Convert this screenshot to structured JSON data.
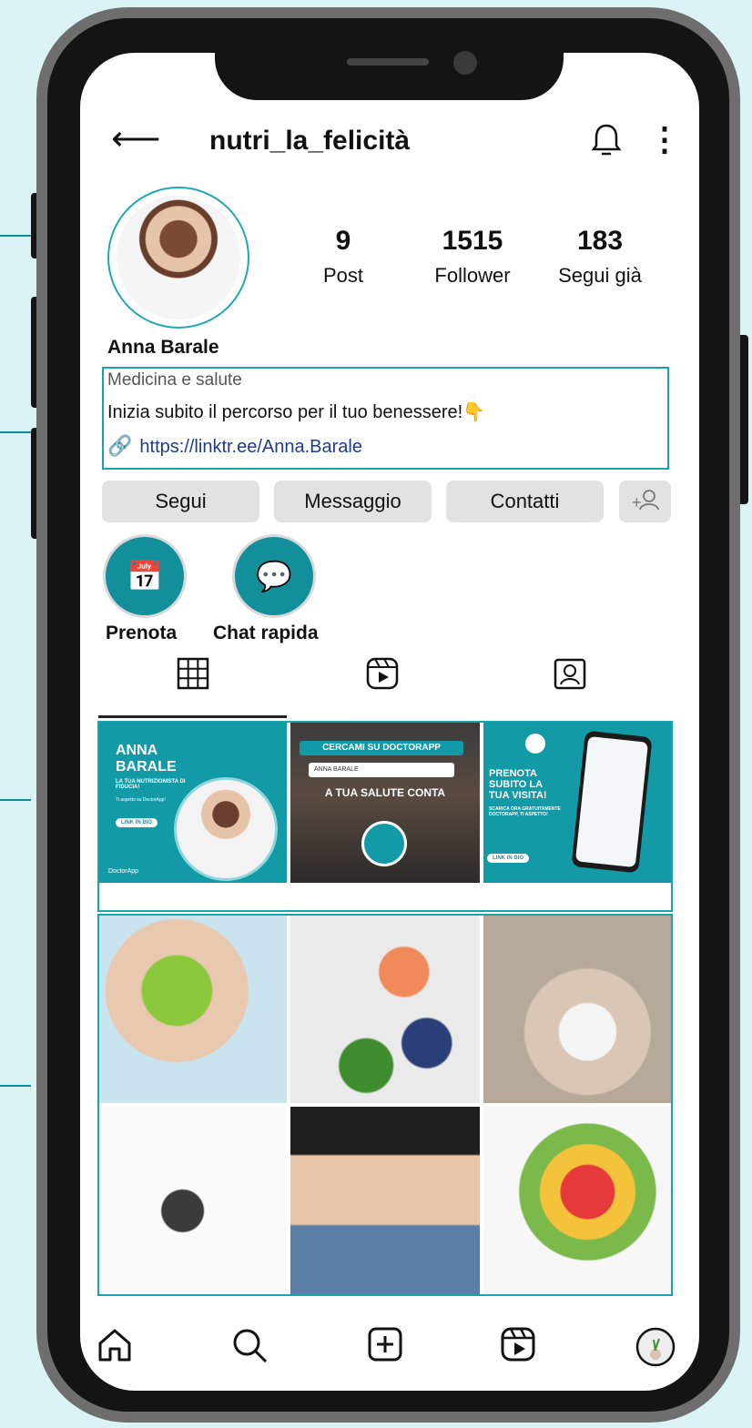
{
  "header": {
    "title": "nutri_la_felicità"
  },
  "stats": [
    {
      "value": "9",
      "label": "Post"
    },
    {
      "value": "1515",
      "label": "Follower"
    },
    {
      "value": "183",
      "label": "Segui già"
    }
  ],
  "profile": {
    "name": "Anna Barale",
    "category": "Medicina e salute",
    "bio": "Inizia subito il percorso per il tuo benessere!👇",
    "link": "https://linktr.ee/Anna.Barale"
  },
  "actions": {
    "follow": "Segui",
    "message": "Messaggio",
    "contacts": "Contatti"
  },
  "highlights": [
    {
      "label": "Prenota"
    },
    {
      "label": "Chat rapida"
    }
  ],
  "posts": {
    "post1": {
      "line1": "ANNA",
      "line2": "BARALE",
      "sub": "LA TUA NUTRIZIONISTA DI FIDUCIA!",
      "note": "Ti aspetto su DoctorApp!",
      "button": "LINK IN BIO",
      "brand": "DoctorApp"
    },
    "post2": {
      "banner": "CERCAMI SU DOCTORAPP",
      "search": "ANNA BARALE",
      "caption": "A TUA SALUTE CONTA"
    },
    "post3": {
      "line1": "PRENOTA",
      "line2": "SUBITO LA",
      "line3": "TUA VISITA!",
      "sub": "SCARICA ORA GRATUITAMENTE DOCTORAPP, TI ASPETTO!",
      "button": "LINK IN BIO"
    }
  },
  "colors": {
    "accent": "#129aa7",
    "background": "#dcf3f6",
    "link": "#1f3c8a"
  }
}
